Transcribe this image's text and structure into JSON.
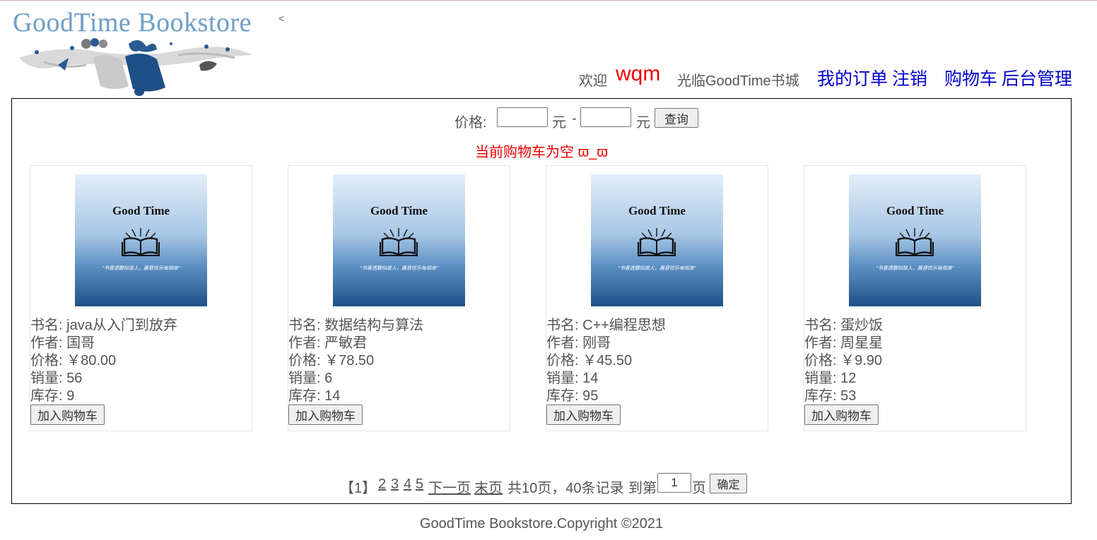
{
  "header": {
    "logo_text": "GoodTime Bookstore",
    "logo_caret": "<",
    "welcome": "欢迎",
    "username": "wqm",
    "welcome_suffix": "光临GoodTime书城",
    "nav": {
      "orders": "我的订单",
      "logout": "注销",
      "cart": "购物车",
      "admin": "后台管理"
    }
  },
  "filter": {
    "label": "价格:",
    "min_value": "",
    "unit1": "元",
    "dash": "-",
    "max_value": "",
    "unit2": "元",
    "query_button": "查询"
  },
  "cart_status": "当前购物车为空 ϖ_ϖ",
  "cover": {
    "title": "Good Time",
    "slogan": "\"书香透馥似故人，晨昏忧乐每相亲\""
  },
  "books": [
    {
      "name_label": "书名:",
      "name": "java从入门到放弃",
      "author_label": "作者:",
      "author": "国哥",
      "price_label": "价格:",
      "price": "￥80.00",
      "sales_label": "销量:",
      "sales": "56",
      "stock_label": "库存:",
      "stock": "9",
      "button": "加入购物车"
    },
    {
      "name_label": "书名:",
      "name": "数据结构与算法",
      "author_label": "作者:",
      "author": "严敏君",
      "price_label": "价格:",
      "price": "￥78.50",
      "sales_label": "销量:",
      "sales": "6",
      "stock_label": "库存:",
      "stock": "14",
      "button": "加入购物车"
    },
    {
      "name_label": "书名:",
      "name": "C++编程思想",
      "author_label": "作者:",
      "author": "刚哥",
      "price_label": "价格:",
      "price": "￥45.50",
      "sales_label": "销量:",
      "sales": "14",
      "stock_label": "库存:",
      "stock": "95",
      "button": "加入购物车"
    },
    {
      "name_label": "书名:",
      "name": "蛋炒饭",
      "author_label": "作者:",
      "author": "周星星",
      "price_label": "价格:",
      "price": "￥9.90",
      "sales_label": "销量:",
      "sales": "12",
      "stock_label": "库存:",
      "stock": "53",
      "button": "加入购物车"
    }
  ],
  "pager": {
    "current": "【1】",
    "pages": [
      "2",
      "3",
      "4",
      "5"
    ],
    "next": "下一页",
    "last": "末页",
    "summary": "共10页，40条记录",
    "goto_label": "到第",
    "goto_value": "1",
    "goto_suffix": "页",
    "goto_button": "确定"
  },
  "footer": "GoodTime Bookstore.Copyright ©2021",
  "colors": {
    "link": "#0000cc",
    "alert": "#ee0000",
    "text": "#555555"
  }
}
